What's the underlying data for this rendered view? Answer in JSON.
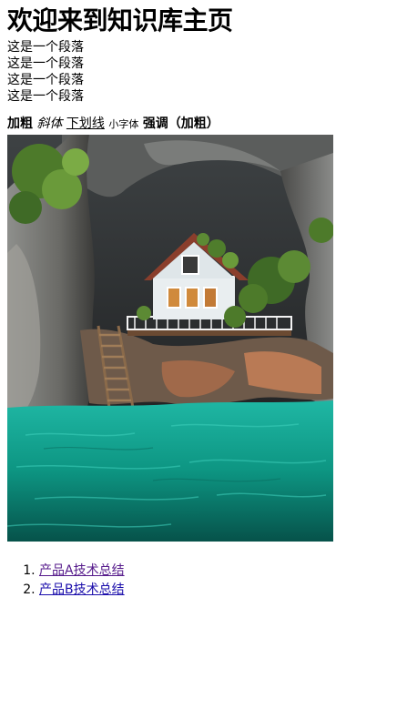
{
  "heading": "欢迎来到知识库主页",
  "paragraphs": [
    "这是一个段落",
    "这是一个段落",
    "这是一个段落",
    "这是一个段落"
  ],
  "inline": {
    "bold": "加粗",
    "italic": "斜体",
    "underline": "下划线",
    "small": "小字体",
    "strong": "强调（加粗）"
  },
  "links": [
    {
      "label": "产品A技术总结"
    },
    {
      "label": "产品B技术总结"
    }
  ],
  "colors": {
    "link": "#1a0dab",
    "link_visited": "#551a8b",
    "water": "#0fa592"
  }
}
